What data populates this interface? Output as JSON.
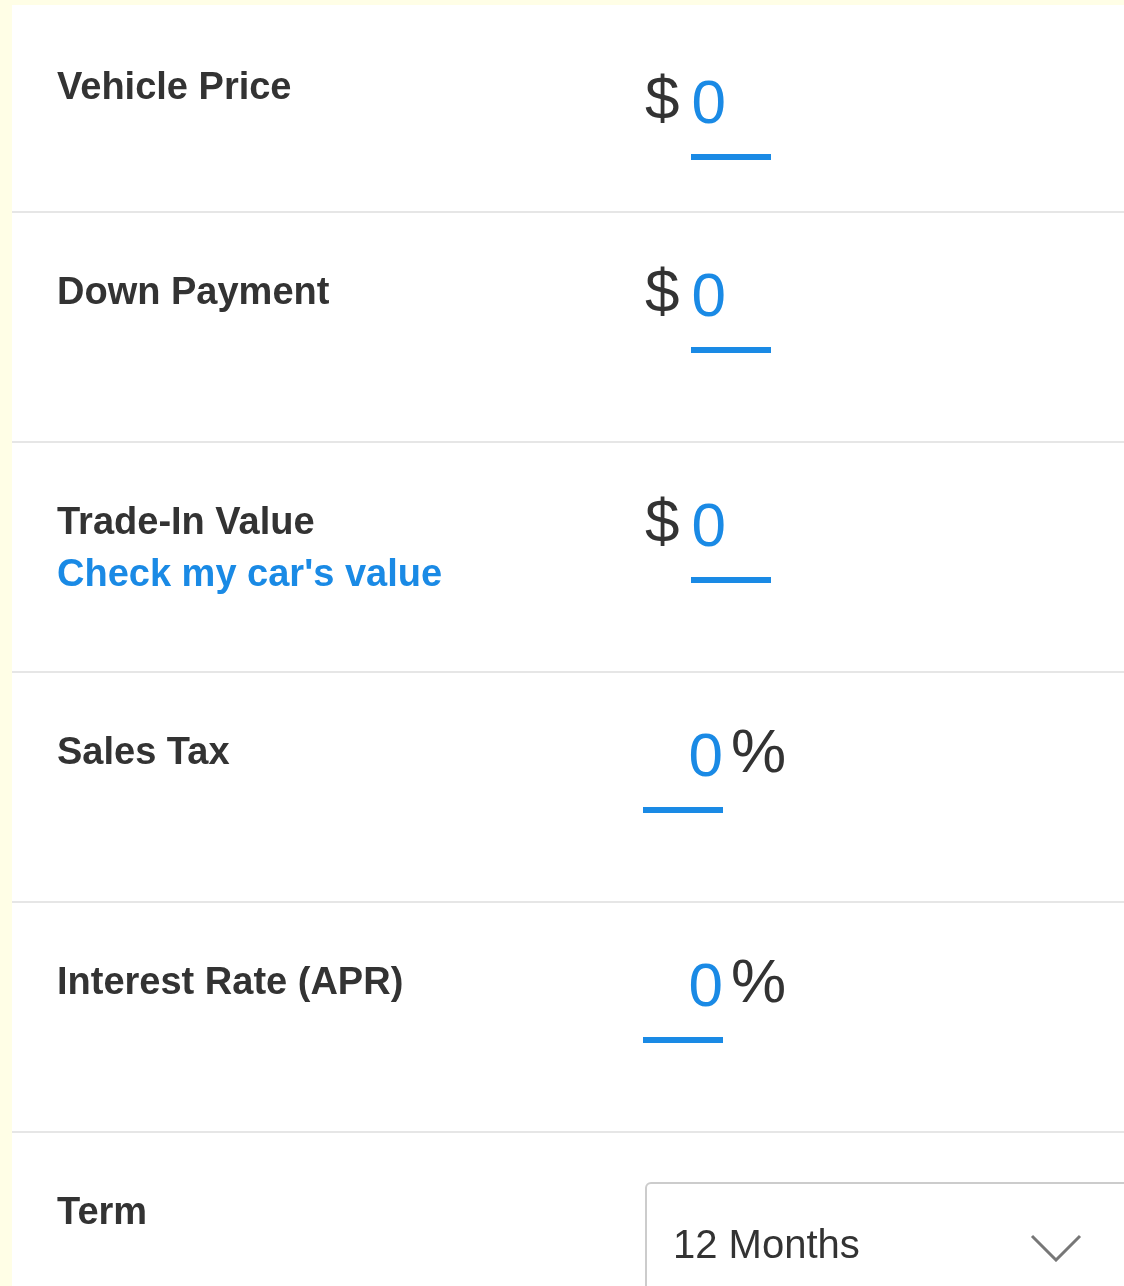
{
  "fields": [
    {
      "kind": "currency",
      "label": "Vehicle Price",
      "prefix": "$",
      "value": "0"
    },
    {
      "kind": "currency",
      "label": "Down Payment",
      "prefix": "$",
      "value": "0"
    },
    {
      "kind": "currency",
      "label": "Trade-In Value",
      "link": "Check my car's value",
      "prefix": "$",
      "value": "0"
    },
    {
      "kind": "percent",
      "label": "Sales Tax",
      "value": "0",
      "suffix": "%"
    },
    {
      "kind": "percent",
      "label": "Interest Rate (APR)",
      "value": "0",
      "suffix": "%"
    },
    {
      "kind": "select",
      "label": "Term",
      "value": "12 Months"
    }
  ]
}
